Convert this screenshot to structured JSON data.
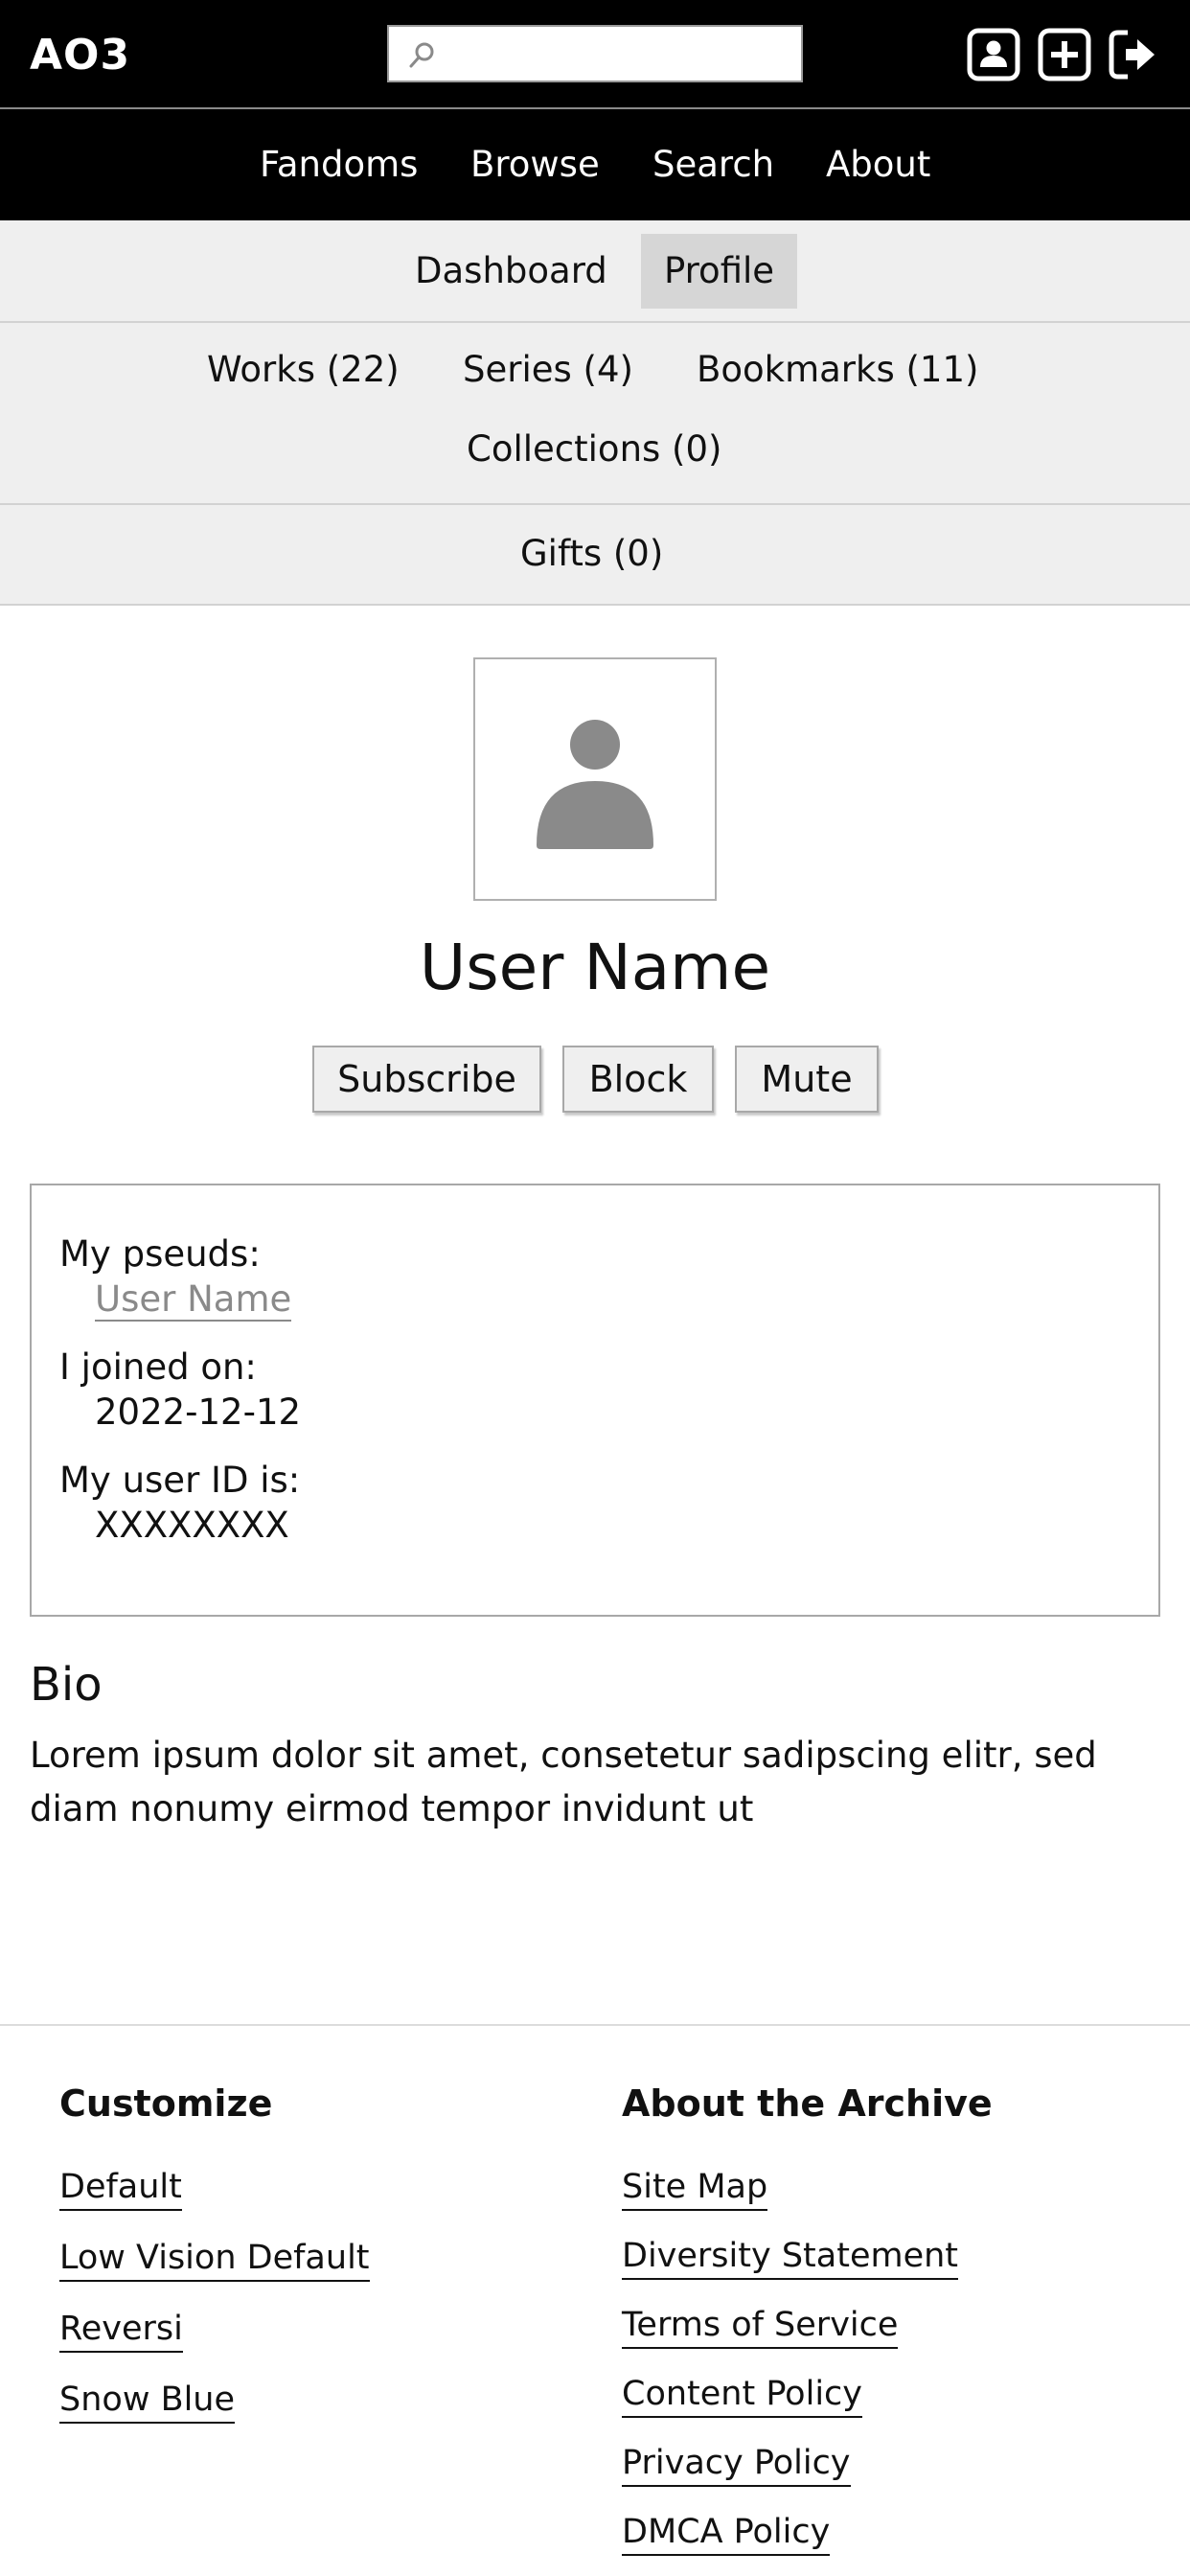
{
  "header": {
    "logo": "AO3",
    "search": {
      "placeholder": "",
      "value": ""
    },
    "icons": [
      "user-profile-icon",
      "plus-icon",
      "log-out-icon"
    ]
  },
  "primary_nav": {
    "items": [
      {
        "label": "Fandoms"
      },
      {
        "label": "Browse"
      },
      {
        "label": "Search"
      },
      {
        "label": "About"
      }
    ]
  },
  "dashboard_nav": {
    "items": [
      {
        "label": "Dashboard"
      },
      {
        "label": "Profile",
        "selected": true
      }
    ]
  },
  "works_nav": {
    "items": [
      {
        "label": "Works (22)"
      },
      {
        "label": "Series (4)"
      },
      {
        "label": "Bookmarks (11)"
      },
      {
        "label": "Collections (0)"
      }
    ]
  },
  "gifts_nav": {
    "label": "Gifts (0)"
  },
  "profile": {
    "user_name": "User Name",
    "buttons": {
      "subscribe": "Subscribe",
      "block": "Block",
      "mute": "Mute"
    },
    "info": {
      "pseuds_label": "My pseuds:",
      "pseud": "User Name",
      "joined_label": "I joined on:",
      "joined": "2022-12-12",
      "user_id_label": "My user ID is:",
      "user_id": "XXXXXXXX"
    },
    "bio": {
      "heading": "Bio",
      "text": "Lorem ipsum dolor sit amet, consetetur sadipscing elitr, sed diam nonumy eirmod tempor invidunt ut"
    }
  },
  "footer": {
    "customize": {
      "heading": "Customize",
      "links": [
        "Default",
        "Low Vision Default",
        "Reversi",
        "Snow Blue"
      ]
    },
    "about": {
      "heading": "About the Archive",
      "links": [
        "Site Map",
        "Diversity Statement",
        "Terms of Service",
        "Content Policy",
        "Privacy Policy",
        "DMCA Policy"
      ]
    }
  },
  "colors": {
    "header_bg": "#000000",
    "subnav_bg": "#efefef",
    "selected_tab": "#d6d6d6",
    "muted_link": "#8a8a8a"
  }
}
